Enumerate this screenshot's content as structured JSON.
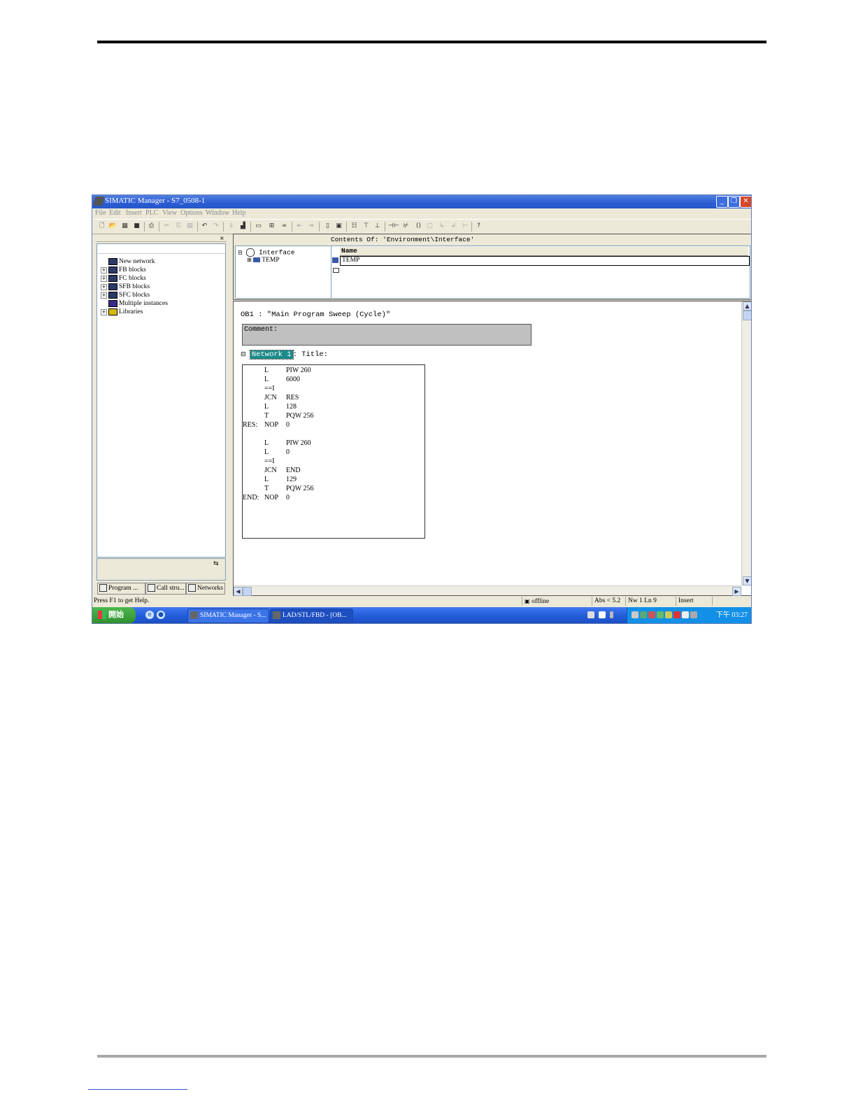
{
  "window": {
    "title": "SIMATIC Manager - S7_0508-1",
    "min_glyph": "_",
    "max_glyph": "❐",
    "close_glyph": "✕"
  },
  "menu": [
    "File",
    "Edit",
    "Insert",
    "PLC",
    "View",
    "Options",
    "Window",
    "Help"
  ],
  "toolbar": {
    "icons": [
      "new-icon",
      "open-icon",
      "accessible-nodes-icon",
      "save-icon",
      "print-icon",
      "cut-icon",
      "copy-icon",
      "paste-icon",
      "undo-icon",
      "redo-icon",
      "download-icon",
      "monitor-icon",
      "overview-icon",
      "network-icon",
      "glasses-icon",
      "first-icon",
      "last-icon",
      "lad-icon",
      "fbd-icon",
      "stl-icon",
      "tree-icon",
      "branch-icon",
      "contact-no-icon",
      "contact-nc-icon",
      "coil-icon",
      "box-icon",
      "branch-open-icon",
      "branch-close-icon",
      "connection-icon",
      "help-icon"
    ]
  },
  "left_pane": {
    "close_glyph": "×",
    "tree": [
      {
        "label": "New network",
        "expand": ""
      },
      {
        "label": "FB blocks",
        "expand": "+"
      },
      {
        "label": "FC blocks",
        "expand": "+"
      },
      {
        "label": "SFB blocks",
        "expand": "+"
      },
      {
        "label": "SFC blocks",
        "expand": "+"
      },
      {
        "label": "Multiple instances",
        "expand": ""
      },
      {
        "label": "Libraries",
        "expand": "+"
      }
    ],
    "tabs": [
      "Program ...",
      "Call stru...",
      "Networks"
    ]
  },
  "interface": {
    "tree_root": "Interface",
    "tree_child": "TEMP",
    "contents_label": "Contents Of: 'Environment\\Interface'",
    "column_header": "Name",
    "row_value": "TEMP"
  },
  "editor": {
    "block_title": "OB1 :  \"Main Program Sweep (Cycle)\"",
    "comment_label": "Comment:",
    "network_tag": "Network 1",
    "network_title": ": Title:",
    "stl": [
      {
        "label": "",
        "op": "L",
        "arg": "PIW  260"
      },
      {
        "label": "",
        "op": "L",
        "arg": "6000"
      },
      {
        "label": "",
        "op": "==I",
        "arg": ""
      },
      {
        "label": "",
        "op": "JCN",
        "arg": "RES"
      },
      {
        "label": "",
        "op": "L",
        "arg": "128"
      },
      {
        "label": "",
        "op": "T",
        "arg": "PQW  256"
      },
      {
        "label": "RES:",
        "op": "NOP",
        "arg": "0"
      },
      {
        "label": "",
        "op": "",
        "arg": ""
      },
      {
        "label": "",
        "op": "L",
        "arg": "PIW  260"
      },
      {
        "label": "",
        "op": "L",
        "arg": "0"
      },
      {
        "label": "",
        "op": "==I",
        "arg": ""
      },
      {
        "label": "",
        "op": "JCN",
        "arg": "END"
      },
      {
        "label": "",
        "op": "L",
        "arg": "129"
      },
      {
        "label": "",
        "op": "T",
        "arg": "PQW  256"
      },
      {
        "label": "END:",
        "op": "NOP",
        "arg": "0"
      }
    ]
  },
  "status": {
    "help_text": "Press F1 to get Help.",
    "online_state": "offline",
    "abs": "Abs < 5.2",
    "position": "Nw 1  Ln 9",
    "mode": "Insert"
  },
  "taskbar": {
    "start_label": "開始",
    "buttons": [
      "SIMATIC Manager - S...",
      "LAD/STL/FBD - [OB..."
    ],
    "clock": "下午 03:27"
  }
}
